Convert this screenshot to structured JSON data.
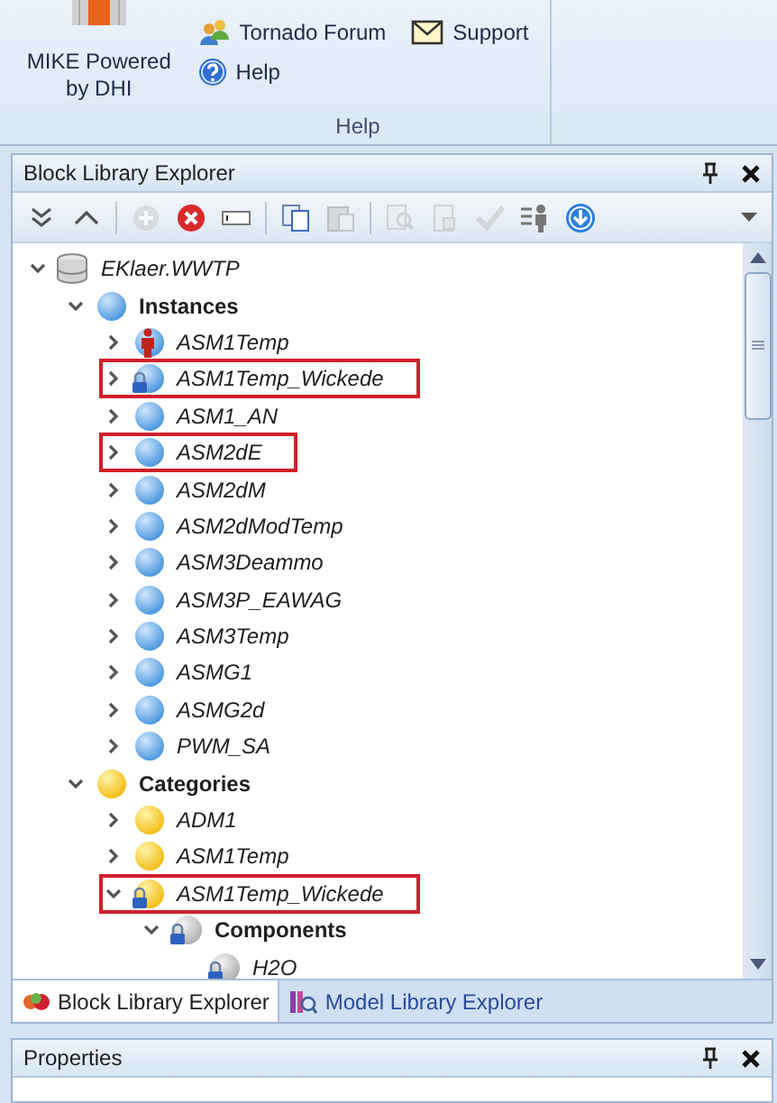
{
  "ribbon": {
    "big_button": "MIKE Powered by DHI",
    "links": [
      {
        "kind": "forum",
        "label": "Tornado Forum"
      },
      {
        "kind": "support",
        "label": "Support"
      },
      {
        "kind": "help",
        "label": "Help"
      }
    ],
    "group_label": "Help"
  },
  "explorer": {
    "title": "Block Library Explorer",
    "toolbar": [
      {
        "kind": "expand-all",
        "disabled": false
      },
      {
        "kind": "collapse",
        "disabled": false
      },
      {
        "kind": "sep"
      },
      {
        "kind": "add",
        "disabled": true
      },
      {
        "kind": "delete",
        "disabled": false
      },
      {
        "kind": "rename",
        "disabled": false
      },
      {
        "kind": "sep"
      },
      {
        "kind": "copy",
        "disabled": false
      },
      {
        "kind": "paste",
        "disabled": true
      },
      {
        "kind": "sep"
      },
      {
        "kind": "inspect",
        "disabled": true
      },
      {
        "kind": "document",
        "disabled": true
      },
      {
        "kind": "check",
        "disabled": true
      },
      {
        "kind": "person-list",
        "disabled": false
      },
      {
        "kind": "download",
        "disabled": false
      }
    ],
    "tree": [
      {
        "label": "EKlaer.WWTP",
        "kind": "database",
        "expanded": true,
        "highlighted": false,
        "children": [
          {
            "label": "Instances",
            "kind": "instance-group",
            "expanded": true,
            "highlighted": false,
            "children": [
              {
                "label": "ASM1Temp",
                "kind": "person-instance",
                "expanded": false,
                "highlighted": false
              },
              {
                "label": "ASM1Temp_Wickede",
                "kind": "instance",
                "locked": true,
                "expanded": false,
                "highlighted": true
              },
              {
                "label": "ASM1_AN",
                "kind": "instance",
                "expanded": false,
                "highlighted": false
              },
              {
                "label": "ASM2dE",
                "kind": "instance",
                "expanded": false,
                "highlighted": true
              },
              {
                "label": "ASM2dM",
                "kind": "instance",
                "expanded": false,
                "highlighted": false
              },
              {
                "label": "ASM2dModTemp",
                "kind": "instance",
                "expanded": false,
                "highlighted": false
              },
              {
                "label": "ASM3Deammo",
                "kind": "instance",
                "expanded": false,
                "highlighted": false
              },
              {
                "label": "ASM3P_EAWAG",
                "kind": "instance",
                "expanded": false,
                "highlighted": false
              },
              {
                "label": "ASM3Temp",
                "kind": "instance",
                "expanded": false,
                "highlighted": false
              },
              {
                "label": "ASMG1",
                "kind": "instance",
                "expanded": false,
                "highlighted": false
              },
              {
                "label": "ASMG2d",
                "kind": "instance",
                "expanded": false,
                "highlighted": false
              },
              {
                "label": "PWM_SA",
                "kind": "instance",
                "expanded": false,
                "highlighted": false
              }
            ]
          },
          {
            "label": "Categories",
            "kind": "category-group",
            "expanded": true,
            "highlighted": false,
            "children": [
              {
                "label": "ADM1",
                "kind": "category",
                "expanded": false,
                "highlighted": false
              },
              {
                "label": "ASM1Temp",
                "kind": "category",
                "expanded": false,
                "highlighted": false
              },
              {
                "label": "ASM1Temp_Wickede",
                "kind": "category",
                "locked": true,
                "expanded": true,
                "highlighted": true,
                "children": [
                  {
                    "label": "Components",
                    "kind": "component-group",
                    "locked": true,
                    "expanded": true,
                    "highlighted": false,
                    "children": [
                      {
                        "label": "H2O",
                        "kind": "component",
                        "locked": true,
                        "highlighted": false
                      }
                    ]
                  }
                ]
              }
            ]
          }
        ]
      }
    ]
  },
  "bottom_tabs": [
    {
      "label": "Block Library Explorer",
      "kind": "blocks",
      "selected": true
    },
    {
      "label": "Model Library Explorer",
      "kind": "models",
      "selected": false
    }
  ],
  "properties": {
    "title": "Properties"
  }
}
